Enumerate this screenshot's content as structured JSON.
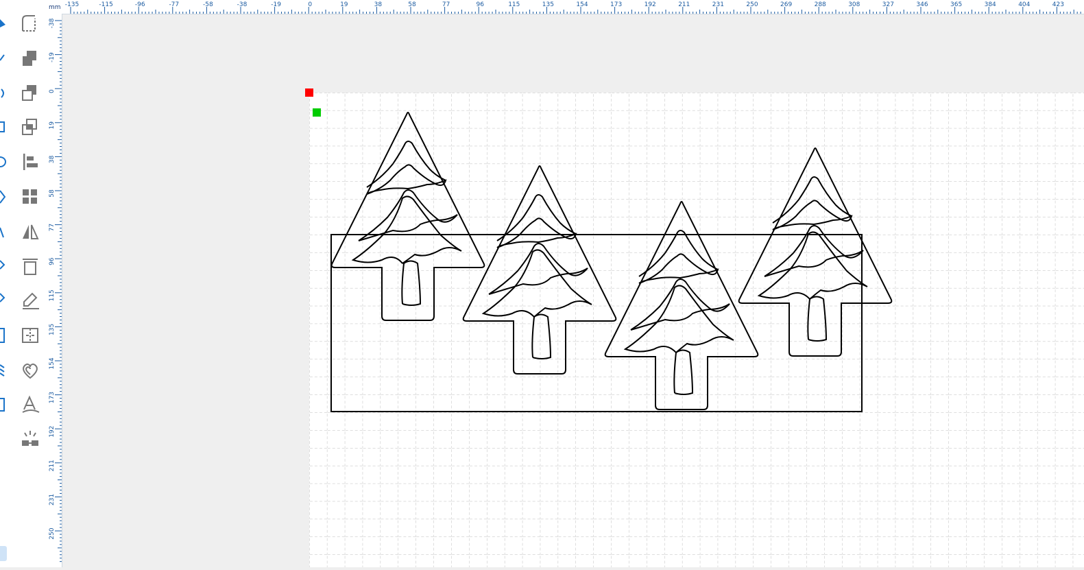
{
  "ruler": {
    "unit": "mm",
    "top_labels": [
      "-135",
      "-115",
      "-96",
      "-77",
      "-58",
      "-38",
      "-19",
      "0",
      "19",
      "38",
      "58",
      "77",
      "96",
      "115",
      "135",
      "154",
      "173",
      "192",
      "211",
      "231",
      "250",
      "269",
      "288",
      "308",
      "327",
      "346",
      "365",
      "384",
      "404",
      "423"
    ],
    "left_labels": [
      "-38",
      "-19",
      "0",
      "19",
      "38",
      "58",
      "77",
      "96",
      "115",
      "135",
      "154",
      "173",
      "192",
      "211",
      "231",
      "250"
    ]
  },
  "toolbar": {
    "tools": [
      {
        "name": "corner-round-icon"
      },
      {
        "name": "union-icon"
      },
      {
        "name": "subtract-icon"
      },
      {
        "name": "intersect-icon"
      },
      {
        "name": "align-left-icon"
      },
      {
        "name": "grid-array-icon"
      },
      {
        "name": "mirror-icon"
      },
      {
        "name": "resize-frame-icon"
      },
      {
        "name": "edit-path-icon"
      },
      {
        "name": "split-frame-icon"
      },
      {
        "name": "offset-heart-icon"
      },
      {
        "name": "text-path-icon"
      },
      {
        "name": "laser-icon"
      }
    ]
  },
  "colors": {
    "accent": "#1a73c9",
    "marker_red": "#ff0000",
    "marker_green": "#00cc00",
    "stroke": "#000000",
    "grid": "#bcbcbc"
  }
}
